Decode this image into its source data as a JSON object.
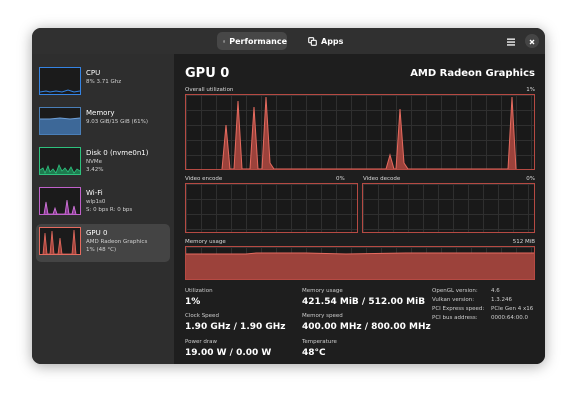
{
  "header": {
    "tabs": [
      {
        "label": "Performance",
        "icon": "gauge-icon",
        "selected": true
      },
      {
        "label": "Apps",
        "icon": "apps-icon",
        "selected": false
      }
    ]
  },
  "sidebar": {
    "items": [
      {
        "label": "CPU",
        "sub1": "8% 3.71 Ghz",
        "sub2": "",
        "color": "#3584e4"
      },
      {
        "label": "Memory",
        "sub1": "9.03 GiB/15 GiB (61%)",
        "sub2": "",
        "color": "#4a7fb8"
      },
      {
        "label": "Disk 0 (nvme0n1)",
        "sub1": "NVMe",
        "sub2": "3.42%",
        "color": "#2ec27e"
      },
      {
        "label": "Wi-Fi",
        "sub1": "wlp1s0",
        "sub2": "S: 0 bps R: 0 bps",
        "color": "#c061cb"
      },
      {
        "label": "GPU 0",
        "sub1": "AMD Radeon Graphics",
        "sub2": "1% (48 °C)",
        "color": "#e66b5f"
      }
    ]
  },
  "main": {
    "title": "GPU 0",
    "device_name": "AMD Radeon Graphics",
    "graphs": {
      "overall": {
        "label": "Overall utilization",
        "value": "1%"
      },
      "video_encode": {
        "label": "Video encode",
        "value": "0%"
      },
      "video_decode": {
        "label": "Video decode",
        "value": "0%"
      },
      "memory": {
        "label": "Memory usage",
        "value": "512 MiB"
      }
    },
    "stats": [
      {
        "label": "Utilization",
        "value": "1%"
      },
      {
        "label": "Memory usage",
        "value": "421.54 MiB / 512.00 MiB"
      },
      {
        "label": "Clock Speed",
        "value": "1.90 GHz / 1.90 GHz"
      },
      {
        "label": "Memory speed",
        "value": "400.00 MHz / 800.00 MHz"
      },
      {
        "label": "Power draw",
        "value": "19.00 W / 0.00 W"
      },
      {
        "label": "Temperature",
        "value": "48°C"
      }
    ],
    "details": [
      {
        "label": "OpenGL version:",
        "value": "4.6"
      },
      {
        "label": "Vulkan version:",
        "value": "1.3.246"
      },
      {
        "label": "PCI Express speed:",
        "value": "PCIe Gen 4 x16"
      },
      {
        "label": "PCI bus address:",
        "value": "0000:64:00.0"
      }
    ]
  }
}
